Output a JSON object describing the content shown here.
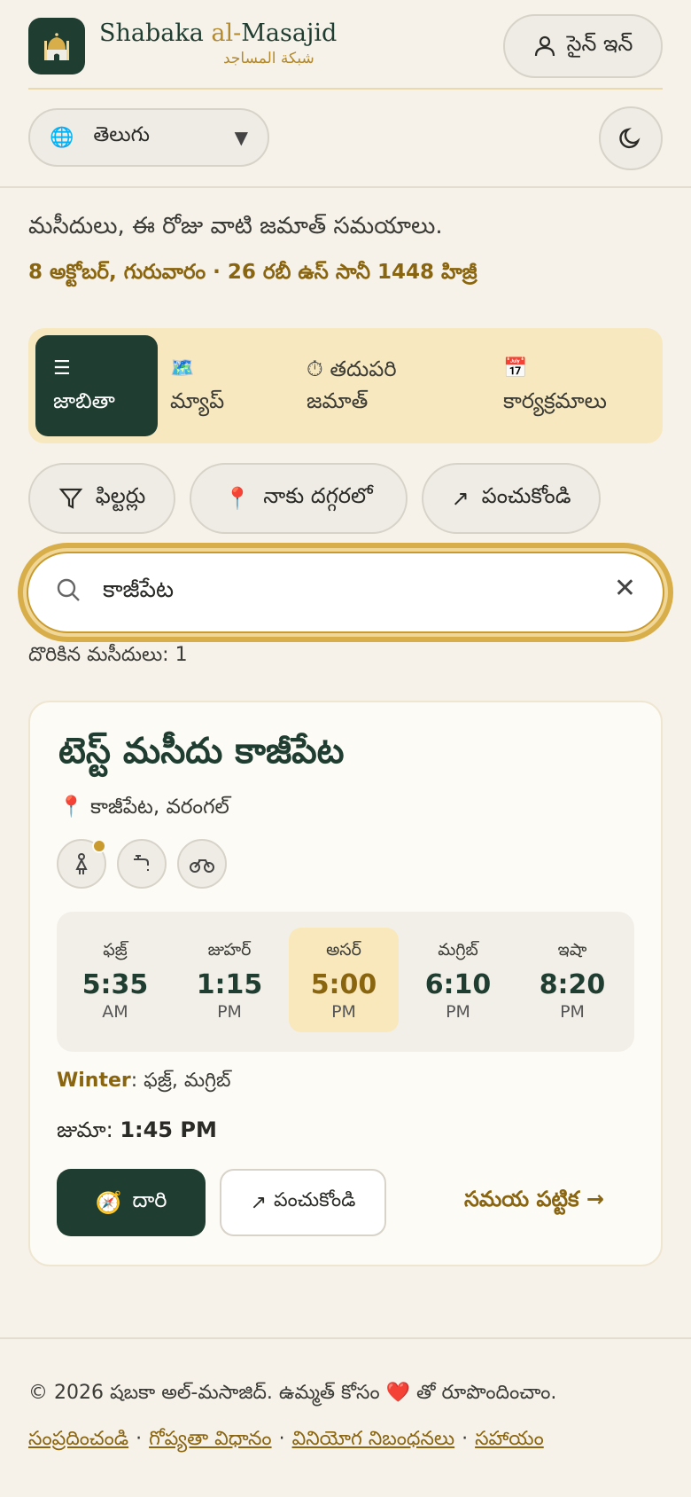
{
  "brand": {
    "name_prefix": "Shabaka ",
    "name_al": "al-",
    "name_suffix": "Masajid",
    "name_ar": "شبكة المساجد"
  },
  "header": {
    "signin_label": "సైన్ ఇన్",
    "language": "తెలుగు"
  },
  "intro": {
    "subtitle": "మసీదులు, ఈ రోజు వాటి జమాత్ సమయాలు.",
    "date": "8 అక్టోబర్, గురువారం · 26 రబీ ఉస్ సానీ 1448 హిజ్రీ"
  },
  "tabs": [
    {
      "label": "జాబితా",
      "icon": "list-icon"
    },
    {
      "label": "మ్యాప్",
      "icon": "map-icon"
    },
    {
      "label_line1": "తదుపరి",
      "label_line2": "జమాత్",
      "icon": "stopwatch-icon"
    },
    {
      "label": "కార్యక్రమాలు",
      "icon": "calendar-icon"
    }
  ],
  "chips": {
    "filters": "ఫిల్టర్లు",
    "nearby": "నాకు దగ్గరలో",
    "share": "పంచుకోండి"
  },
  "search": {
    "value": "కాజీపేట"
  },
  "results": {
    "count_label": "దొరికిన మసీదులు: 1"
  },
  "mosque": {
    "name": "టెస్ట్ మసీదు కాజీపేట",
    "location": "కాజీపేట, వరంగల్",
    "amenities": [
      "women-icon",
      "wudu-tap-icon",
      "bike-parking-icon"
    ],
    "prayers": [
      {
        "name": "ఫజ్ర్",
        "time": "5:35",
        "ampm": "AM"
      },
      {
        "name": "జుహర్",
        "time": "1:15",
        "ampm": "PM"
      },
      {
        "name": "అసర్",
        "time": "5:00",
        "ampm": "PM",
        "highlight": true
      },
      {
        "name": "మగ్రిబ్",
        "time": "6:10",
        "ampm": "PM"
      },
      {
        "name": "ఇషా",
        "time": "8:20",
        "ampm": "PM"
      }
    ],
    "winter_label": "Winter",
    "winter_value": ": ఫజ్ర్, మగ్రిబ్",
    "jumuah_label": "జుమా: ",
    "jumuah_time": "1:45 PM",
    "directions_label": "దారి",
    "share_label": "పంచుకోండి",
    "schedule_label": "సమయ పట్టిక →"
  },
  "footer": {
    "copyright_pre": "© 2026 షబకా అల్-మసాజిద్. ఉమ్మత్ కోసం",
    "copyright_post": "తో రూపొందించాం.",
    "links": [
      "సంప్రదించండి",
      "గోప్యతా విధానం",
      "వినియోగ నిబంధనలు",
      "సహాయం"
    ]
  },
  "colors": {
    "brand_green": "#1f3d30",
    "gold": "#8a6510",
    "tab_bg": "#f7e8bf",
    "highlight": "#f8e8bc"
  }
}
